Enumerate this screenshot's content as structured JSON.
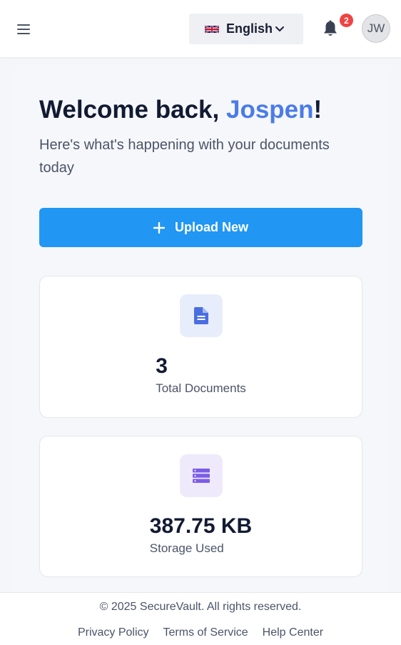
{
  "header": {
    "menu_icon": "hamburger-menu-icon",
    "language": {
      "selected": "English",
      "flag_icon": "uk-flag-icon",
      "chevron_icon": "chevron-down-icon"
    },
    "notifications": {
      "icon": "bell-icon",
      "count": "2"
    },
    "avatar_initials": "JW"
  },
  "main": {
    "welcome_prefix": "Welcome back, ",
    "user_name": "Jospen",
    "welcome_suffix": "!",
    "subtitle": "Here's what's happening with your documents today",
    "upload_button": {
      "label": "Upload New",
      "icon": "plus-icon"
    },
    "stats": [
      {
        "value": "3",
        "label": "Total Documents",
        "icon": "document-icon",
        "color": "#4a6ee0"
      },
      {
        "value": "387.75 KB",
        "label": "Storage Used",
        "icon": "database-icon",
        "color": "#7b5ce6"
      }
    ]
  },
  "footer": {
    "copyright": "© 2025 SecureVault. All rights reserved.",
    "links": [
      "Privacy Policy",
      "Terms of Service",
      "Help Center"
    ]
  },
  "colors": {
    "accent": "#2196f3",
    "name_highlight": "#4a7be8",
    "badge": "#ef4444"
  }
}
